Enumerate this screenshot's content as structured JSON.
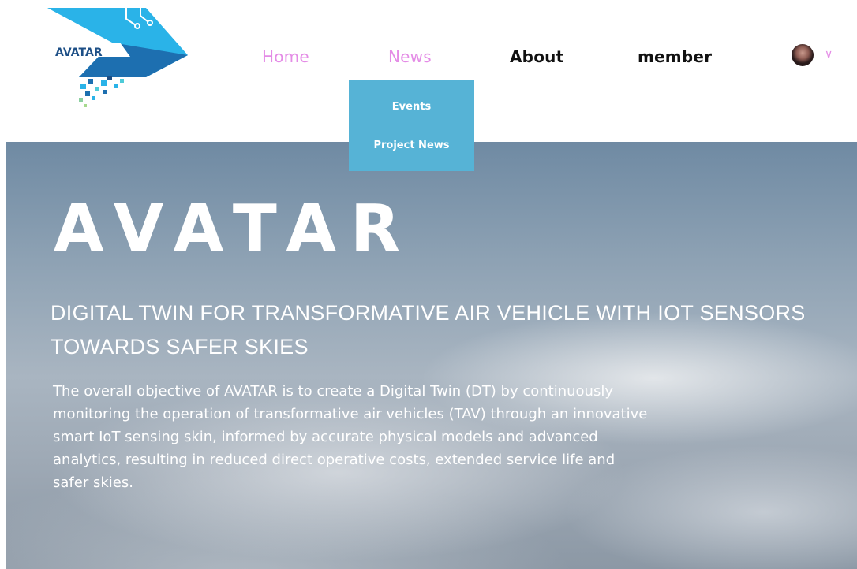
{
  "logo": {
    "text": "AVATAR",
    "colors": {
      "primary": "#1d6fb0",
      "light": "#2ab3e8",
      "text": "#1d4f86"
    }
  },
  "nav": {
    "items": [
      {
        "label": "Home"
      },
      {
        "label": "News"
      },
      {
        "label": "About"
      },
      {
        "label": "member"
      }
    ],
    "active_color": "#e48ce6"
  },
  "user_menu": {
    "icon": "avatar",
    "chevron_icon": "chevron-down-icon"
  },
  "dropdown": {
    "background": "#56b3d6",
    "items": [
      {
        "label": "Events"
      },
      {
        "label": "Project News"
      }
    ]
  },
  "hero": {
    "title": "AVATAR",
    "subtitle": "DIGITAL TWIN FOR TRANSFORMATIVE AIR VEHICLE WITH IOT SENSORS TOWARDS SAFER SKIES",
    "body": "The overall objective of AVATAR is to create a Digital Twin (DT) by continuously monitoring the operation of transformative air vehicles (TAV) through an innovative smart IoT sensing skin, informed by accurate physical models and advanced analytics, resulting in reduced direct operative costs, extended service life and safer skies."
  }
}
